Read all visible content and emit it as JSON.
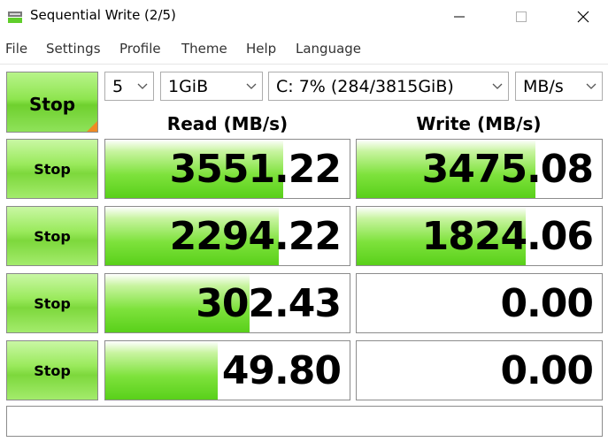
{
  "window": {
    "title": "Sequential Write (2/5)"
  },
  "menu": [
    "File",
    "Settings",
    "Profile",
    "Theme",
    "Help",
    "Language"
  ],
  "controls": {
    "all_button": "Stop",
    "count": "5",
    "size": "1GiB",
    "drive": "C: 7% (284/3815GiB)",
    "unit": "MB/s"
  },
  "headers": {
    "read": "Read (MB/s)",
    "write": "Write (MB/s)"
  },
  "rows": [
    {
      "button": "Stop",
      "read": "3551.22",
      "write": "3475.08",
      "read_fill": 0.73,
      "write_fill": 0.73
    },
    {
      "button": "Stop",
      "read": "2294.22",
      "write": "1824.06",
      "read_fill": 0.71,
      "write_fill": 0.69
    },
    {
      "button": "Stop",
      "read": "302.43",
      "write": "0.00",
      "read_fill": 0.59,
      "write_fill": 0
    },
    {
      "button": "Stop",
      "read": "49.80",
      "write": "0.00",
      "read_fill": 0.46,
      "write_fill": 0
    }
  ],
  "comment": ""
}
